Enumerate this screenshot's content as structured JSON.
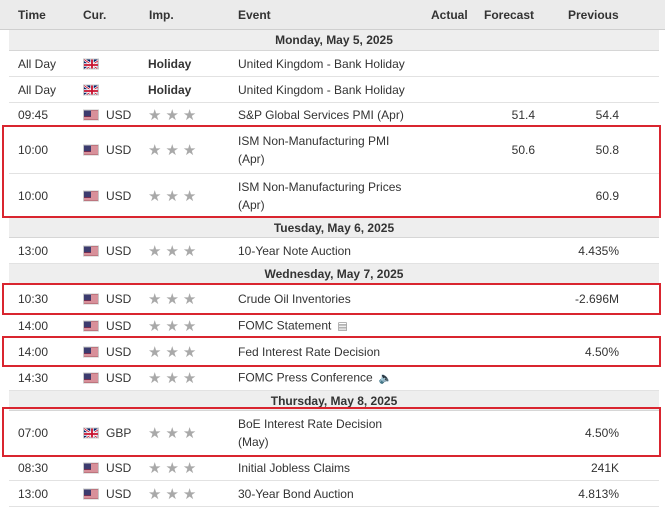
{
  "header": {
    "time": "Time",
    "cur": "Cur.",
    "imp": "Imp.",
    "event": "Event",
    "actual": "Actual",
    "forecast": "Forecast",
    "previous": "Previous"
  },
  "colors": {
    "highlight": "#d9252f",
    "star": "#a9a9a9",
    "header_bg": "#ebebeb",
    "date_bg": "#eeeeee"
  },
  "dates": {
    "d1": "Monday, May 5, 2025",
    "d2": "Tuesday, May 6, 2025",
    "d3": "Wednesday, May 7, 2025",
    "d4": "Thursday, May 8, 2025"
  },
  "rows": [
    {
      "time": "All Day",
      "flag": "gb-flag-icon",
      "cur": "",
      "imp": "Holiday",
      "event": "United Kingdom - Bank Holiday",
      "actual": "",
      "forecast": "",
      "previous": ""
    },
    {
      "time": "All Day",
      "flag": "gb-flag-icon",
      "cur": "",
      "imp": "Holiday",
      "event": "United Kingdom - Bank Holiday",
      "actual": "",
      "forecast": "",
      "previous": ""
    },
    {
      "time": "09:45",
      "flag": "us-flag-icon",
      "cur": "USD",
      "stars": 3,
      "event": "S&P Global Services PMI (Apr)",
      "actual": "",
      "forecast": "51.4",
      "previous": "54.4"
    },
    {
      "time": "10:00",
      "flag": "us-flag-icon",
      "cur": "USD",
      "stars": 3,
      "event_line1": "ISM Non-Manufacturing PMI",
      "event_line2": "(Apr)",
      "actual": "",
      "forecast": "50.6",
      "previous": "50.8"
    },
    {
      "time": "10:00",
      "flag": "us-flag-icon",
      "cur": "USD",
      "stars": 3,
      "event_line1": "ISM Non-Manufacturing Prices",
      "event_line2": "(Apr)",
      "actual": "",
      "forecast": "",
      "previous": "60.9"
    },
    {
      "time": "13:00",
      "flag": "us-flag-icon",
      "cur": "USD",
      "stars": 3,
      "event": "10-Year Note Auction",
      "actual": "",
      "forecast": "",
      "previous": "4.435%"
    },
    {
      "time": "10:30",
      "flag": "us-flag-icon",
      "cur": "USD",
      "stars": 3,
      "event": "Crude Oil Inventories",
      "actual": "",
      "forecast": "",
      "previous": "-2.696M"
    },
    {
      "time": "14:00",
      "flag": "us-flag-icon",
      "cur": "USD",
      "stars": 3,
      "event": "FOMC Statement",
      "actual": "",
      "forecast": "",
      "previous": ""
    },
    {
      "time": "14:00",
      "flag": "us-flag-icon",
      "cur": "USD",
      "stars": 3,
      "event": "Fed Interest Rate Decision",
      "actual": "",
      "forecast": "",
      "previous": "4.50%"
    },
    {
      "time": "14:30",
      "flag": "us-flag-icon",
      "cur": "USD",
      "stars": 3,
      "event": "FOMC Press Conference",
      "actual": "",
      "forecast": "",
      "previous": ""
    },
    {
      "time": "07:00",
      "flag": "gb-flag-icon",
      "cur": "GBP",
      "stars": 3,
      "event_line1": "BoE Interest Rate Decision",
      "event_line2": "(May)",
      "actual": "",
      "forecast": "",
      "previous": "4.50%"
    },
    {
      "time": "08:30",
      "flag": "us-flag-icon",
      "cur": "USD",
      "stars": 3,
      "event": "Initial Jobless Claims",
      "actual": "",
      "forecast": "",
      "previous": "241K"
    },
    {
      "time": "13:00",
      "flag": "us-flag-icon",
      "cur": "USD",
      "stars": 3,
      "event": "30-Year Bond Auction",
      "actual": "",
      "forecast": "",
      "previous": "4.813%"
    }
  ],
  "icons": {
    "statement": "document-icon",
    "press": "speaker-icon",
    "star": "star-icon"
  }
}
